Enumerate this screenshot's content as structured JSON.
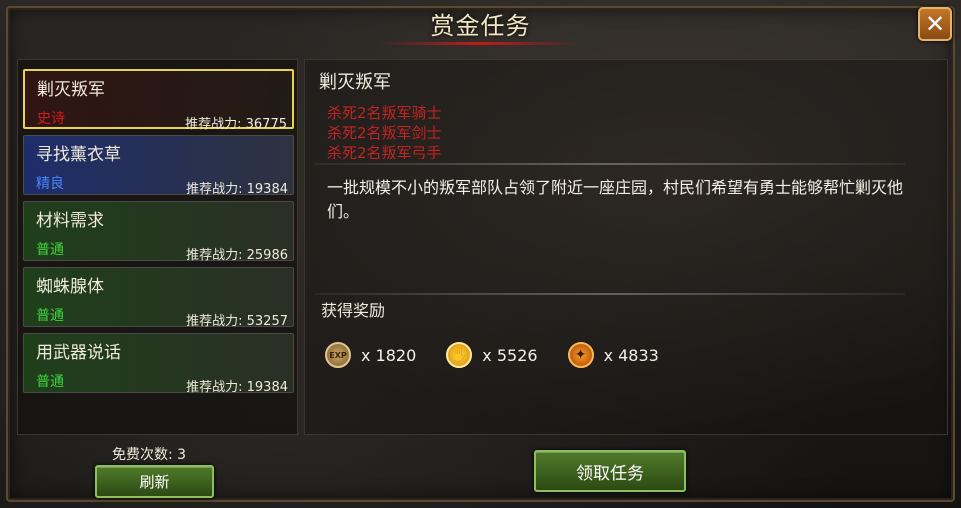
{
  "window": {
    "title": "赏金任务"
  },
  "tasks": [
    {
      "name": "剿灭叛军",
      "rarity": "史诗",
      "power_label": "推荐战力: 36775"
    },
    {
      "name": "寻找薰衣草",
      "rarity": "精良",
      "power_label": "推荐战力: 19384"
    },
    {
      "name": "材料需求",
      "rarity": "普通",
      "power_label": "推荐战力: 25986"
    },
    {
      "name": "蜘蛛腺体",
      "rarity": "普通",
      "power_label": "推荐战力: 53257"
    },
    {
      "name": "用武器说话",
      "rarity": "普通",
      "power_label": "推荐战力: 19384"
    }
  ],
  "detail": {
    "title": "剿灭叛军",
    "objectives": [
      "杀死2名叛军骑士",
      "杀死2名叛军剑士",
      "杀死2名叛军弓手"
    ],
    "description": "一批规模不小的叛军部队占领了附近一座庄园，村民们希望有勇士能够帮忙剿灭他们。",
    "reward_title": "获得奖励",
    "rewards": [
      {
        "icon": "exp-icon",
        "label": "EXP",
        "value": "x 1820"
      },
      {
        "icon": "gold-coin-icon",
        "value": "x 5526"
      },
      {
        "icon": "honor-icon",
        "value": "x 4833"
      }
    ]
  },
  "footer": {
    "free_count": "免费次数: 3",
    "refresh_label": "刷新",
    "accept_label": "领取任务"
  },
  "colors": {
    "legendary": "#d21c1c",
    "fine": "#4a86ff",
    "normal": "#3fd43f",
    "objective": "#c42323",
    "selected_border": "#e7d44c"
  }
}
